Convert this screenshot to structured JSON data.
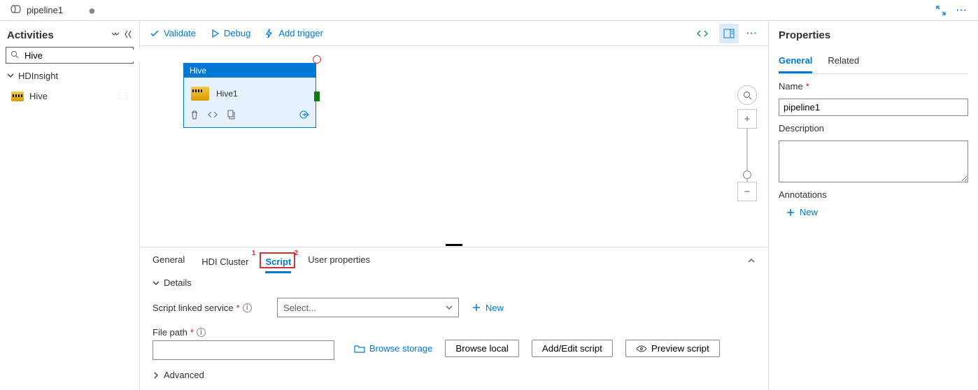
{
  "tab": {
    "title": "pipeline1",
    "dirty": "●"
  },
  "activities": {
    "heading": "Activities",
    "search_value": "Hive",
    "group": "HDInsight",
    "items": [
      {
        "label": "Hive"
      }
    ]
  },
  "toolbar": {
    "validate": "Validate",
    "debug": "Debug",
    "add_trigger": "Add trigger"
  },
  "node": {
    "type": "Hive",
    "name": "Hive1"
  },
  "bottom_tabs": {
    "general": "General",
    "hdi_cluster": "HDI Cluster",
    "script": "Script",
    "user_properties": "User properties",
    "sup1": "1",
    "sup2": "2"
  },
  "script_panel": {
    "details": "Details",
    "linked_service_label": "Script linked service",
    "select_placeholder": "Select...",
    "new": "New",
    "file_path_label": "File path",
    "browse_storage": "Browse storage",
    "browse_local": "Browse local",
    "add_edit": "Add/Edit script",
    "preview": "Preview script",
    "advanced": "Advanced"
  },
  "properties": {
    "heading": "Properties",
    "tabs": {
      "general": "General",
      "related": "Related"
    },
    "name_label": "Name",
    "name_value": "pipeline1",
    "description_label": "Description",
    "description_value": "",
    "annotations_label": "Annotations",
    "new": "New"
  }
}
